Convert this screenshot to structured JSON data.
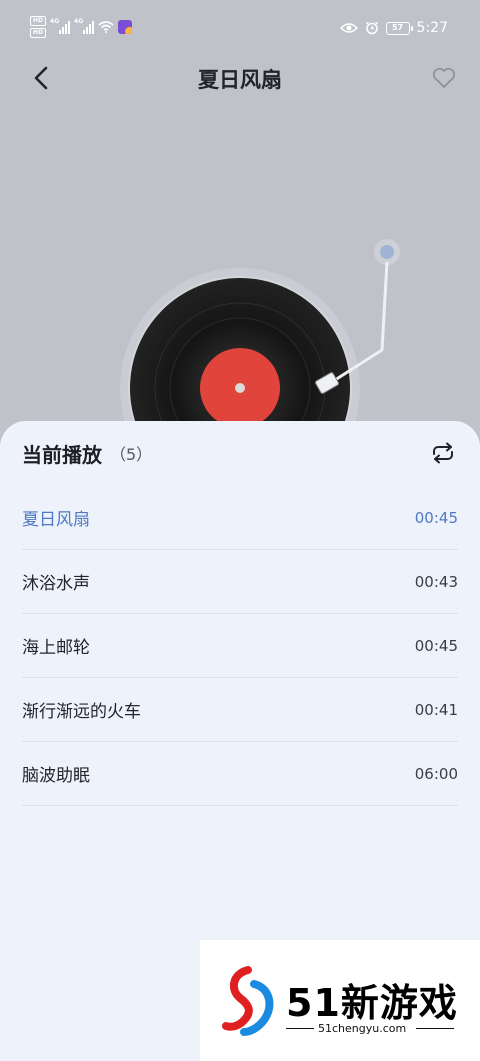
{
  "status_bar": {
    "hd1": "HD",
    "hd2": "HD",
    "net1": "4G",
    "net2": "4G",
    "battery": "57",
    "time": "5:27"
  },
  "header": {
    "title": "夏日风扇"
  },
  "playlist": {
    "title": "当前播放",
    "count": "（5）",
    "tracks": [
      {
        "name": "夏日风扇",
        "duration": "00:45"
      },
      {
        "name": "沐浴水声",
        "duration": "00:43"
      },
      {
        "name": "海上邮轮",
        "duration": "00:45"
      },
      {
        "name": "渐行渐远的火车",
        "duration": "00:41"
      },
      {
        "name": "脑波助眠",
        "duration": "06:00"
      }
    ]
  },
  "watermark": {
    "brand": "51新游戏",
    "url": "51chengyu.com"
  },
  "colors": {
    "background": "#bfc2c8",
    "sheet": "#eef2fb",
    "active_track": "#4f79c6",
    "record_label": "#e0443a"
  }
}
